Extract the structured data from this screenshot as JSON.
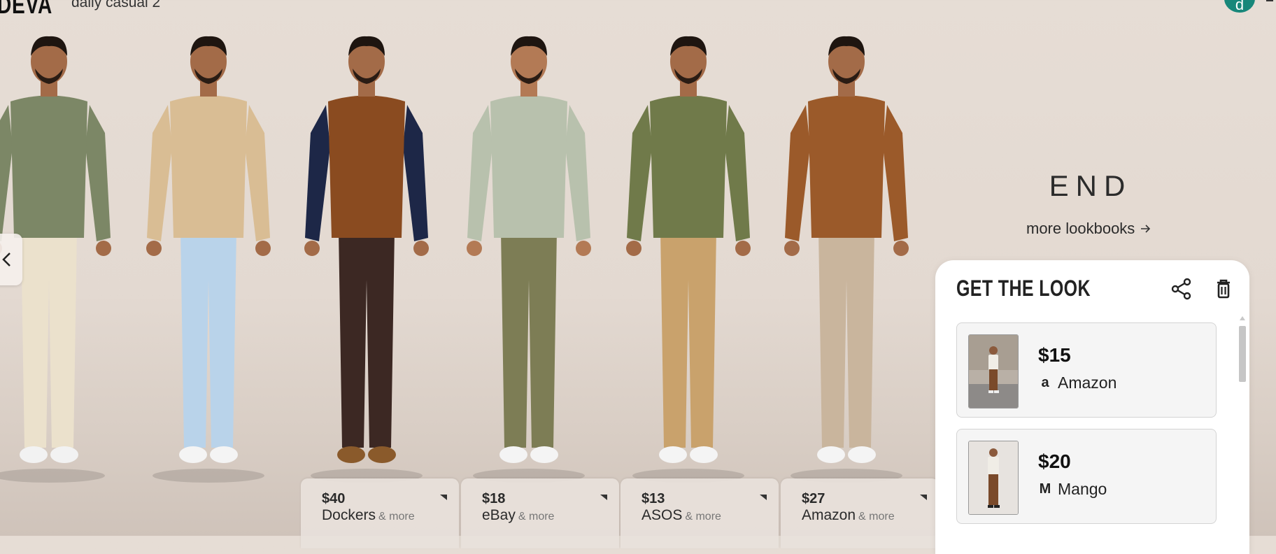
{
  "header": {
    "brand": "DEVA",
    "subtitle": "daily casual 2",
    "avatar_letter": "d"
  },
  "outfits": [
    {
      "name": "outfit-1",
      "top": "#7c8766",
      "bottom": "#ebe1cc",
      "shoes": "#f2f2f2",
      "skin": "#a36b48"
    },
    {
      "name": "outfit-2",
      "top": "#d9bd94",
      "bottom": "#b9d3ea",
      "shoes": "#f4f4f4",
      "skin": "#a36b48"
    },
    {
      "name": "outfit-3",
      "top": "#8a4b20",
      "sleeve": "#1d2747",
      "bottom": "#3c2823",
      "shoes": "#8a5a2b",
      "skin": "#a36b48"
    },
    {
      "name": "outfit-4",
      "top": "#b8c1ad",
      "bottom": "#7d7d55",
      "shoes": "#f4f4f4",
      "skin": "#b37a55"
    },
    {
      "name": "outfit-5",
      "top": "#707a4a",
      "bottom": "#c9a26c",
      "shoes": "#f4f4f4",
      "skin": "#a36b48"
    },
    {
      "name": "outfit-6",
      "top": "#9b5a2a",
      "bottom": "#c9b59d",
      "shoes": "#f4f4f4",
      "skin": "#a36b48"
    }
  ],
  "price_cards": [
    {
      "price": "$40",
      "retailer": "Dockers",
      "more": "& more"
    },
    {
      "price": "$18",
      "retailer": "eBay",
      "more": "& more"
    },
    {
      "price": "$13",
      "retailer": "ASOS",
      "more": "& more"
    },
    {
      "price": "$27",
      "retailer": "Amazon",
      "more": "& more"
    }
  ],
  "end_section": {
    "end_label": "END",
    "more_link": "more lookbooks"
  },
  "get_the_look": {
    "title": "GET THE LOOK",
    "items": [
      {
        "price": "$15",
        "store": "Amazon",
        "logo": "a"
      },
      {
        "price": "$20",
        "store": "Mango",
        "logo": "M"
      }
    ]
  },
  "colors": {
    "avatar": "#17877a",
    "panel_bg": "#ffffff",
    "page_bg": "#e4dad2"
  },
  "icons": [
    "chevron-left-icon",
    "share-icon",
    "trash-icon",
    "arrow-right-icon",
    "corner-triangle-icon",
    "amazon-logo-icon",
    "mango-logo-icon"
  ]
}
